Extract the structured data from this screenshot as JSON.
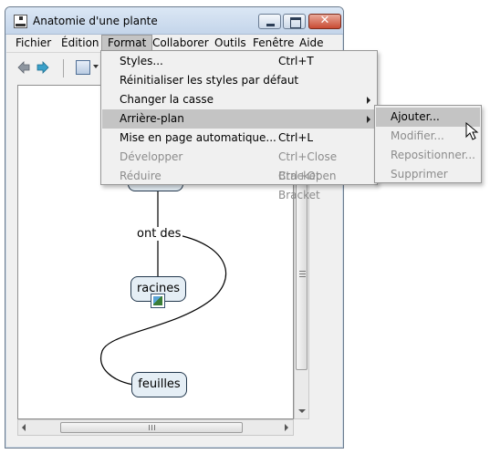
{
  "window": {
    "title": "Anatomie d'une plante"
  },
  "menubar": [
    "Fichier",
    "Édition",
    "Format",
    "Collaborer",
    "Outils",
    "Fenêtre",
    "Aide"
  ],
  "format_menu": {
    "items": [
      {
        "label": "Styles...",
        "shortcut": "Ctrl+T",
        "disabled": false,
        "submenu": false,
        "highlighted": false
      },
      {
        "label": "Réinitialiser les styles par défaut",
        "shortcut": "",
        "disabled": false,
        "submenu": false,
        "highlighted": false
      },
      {
        "label": "Changer la casse",
        "shortcut": "",
        "disabled": false,
        "submenu": true,
        "highlighted": false
      },
      {
        "label": "Arrière-plan",
        "shortcut": "",
        "disabled": false,
        "submenu": true,
        "highlighted": true
      },
      {
        "label": "Mise en page automatique...",
        "shortcut": "Ctrl+L",
        "disabled": false,
        "submenu": false,
        "highlighted": false
      },
      {
        "label": "Développer",
        "shortcut": "Ctrl+Close Bracket",
        "disabled": true,
        "submenu": false,
        "highlighted": false
      },
      {
        "label": "Réduire",
        "shortcut": "Ctrl+Open Bracket",
        "disabled": true,
        "submenu": false,
        "highlighted": false
      }
    ]
  },
  "background_submenu": {
    "items": [
      {
        "label": "Ajouter...",
        "disabled": false,
        "highlighted": true
      },
      {
        "label": "Modifier...",
        "disabled": true,
        "highlighted": false
      },
      {
        "label": "Repositionner...",
        "disabled": true,
        "highlighted": false
      },
      {
        "label": "Supprimer",
        "disabled": true,
        "highlighted": false
      }
    ]
  },
  "map": {
    "concepts": [
      "racines",
      "feuilles"
    ],
    "link_label": "ont des"
  }
}
